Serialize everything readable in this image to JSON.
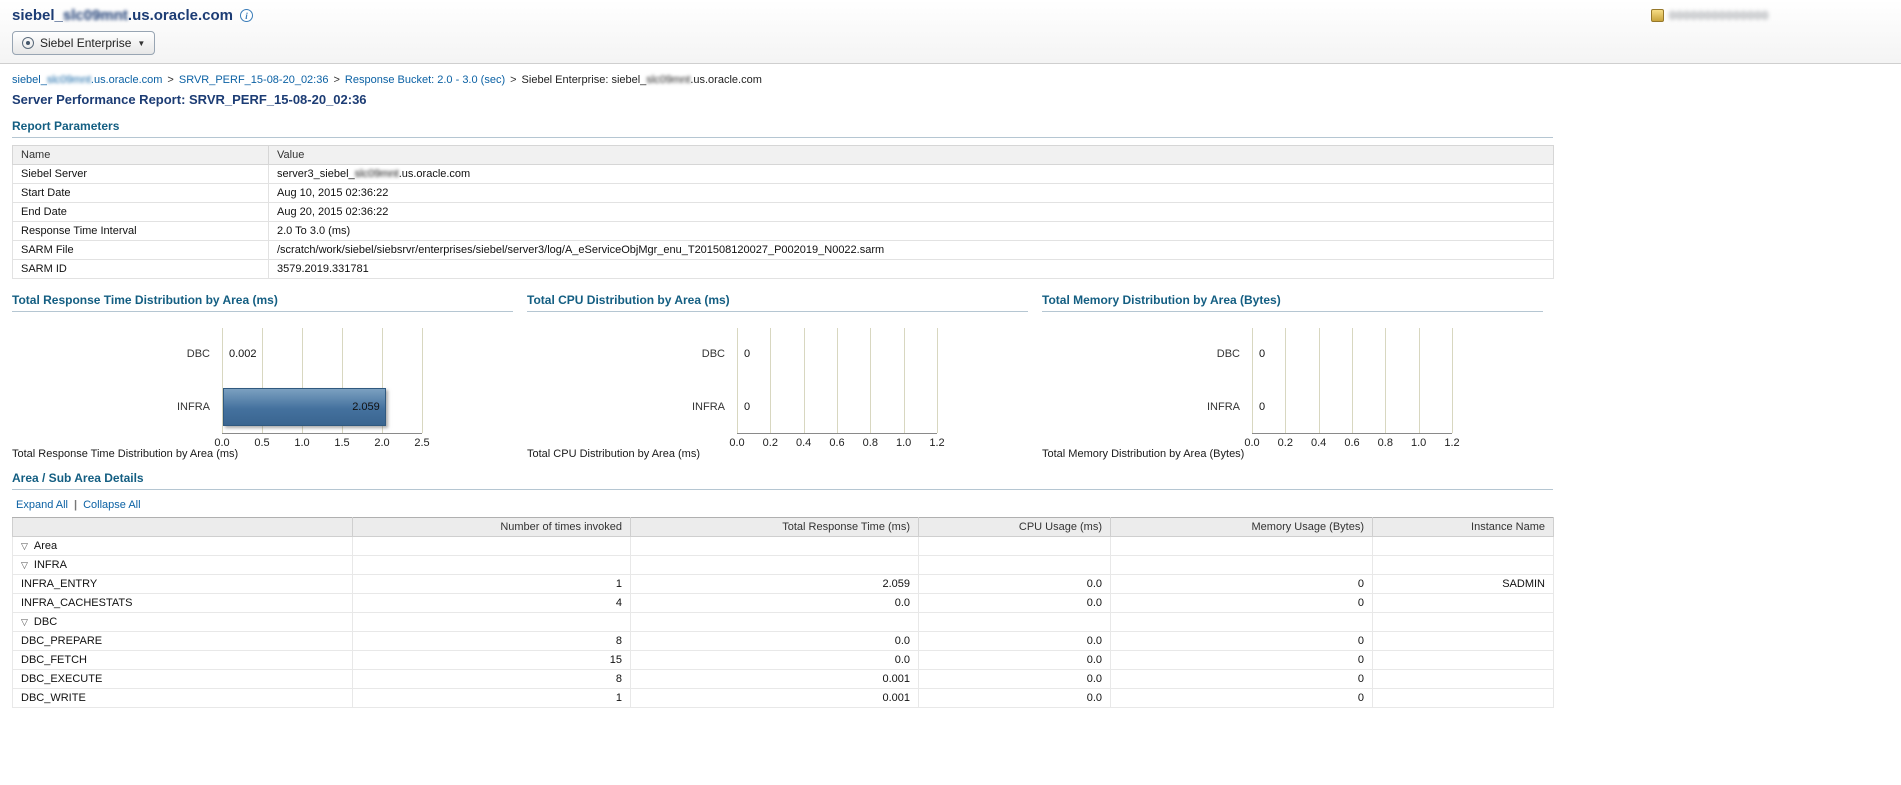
{
  "host": {
    "pre": "siebel_",
    "red": "slc09mnt",
    "post": ".us.oracle.com"
  },
  "header": {
    "info_icon": "i",
    "badge_text": "00000000000000"
  },
  "toolbar": {
    "dropdown_label": "Siebel Enterprise"
  },
  "breadcrumb": {
    "separator": ">",
    "item2": "SRVR_PERF_15-08-20_02:36",
    "item3": "Response Bucket: 2.0 - 3.0 (sec)",
    "item4_prefix": "Siebel Enterprise: "
  },
  "page_title": "Server Performance Report: SRVR_PERF_15-08-20_02:36",
  "report_parameters": {
    "heading": "Report Parameters",
    "columns": [
      "Name",
      "Value"
    ],
    "rows": [
      {
        "name": "Siebel Server",
        "value_prefix": "server3_"
      },
      {
        "name": "Start Date",
        "value": "Aug 10, 2015 02:36:22"
      },
      {
        "name": "End Date",
        "value": "Aug 20, 2015 02:36:22"
      },
      {
        "name": "Response Time Interval",
        "value": "2.0 To 3.0 (ms)"
      },
      {
        "name": "SARM File",
        "value": "/scratch/work/siebel/siebsrvr/enterprises/siebel/server3/log/A_eServiceObjMgr_enu_T201508120027_P002019_N0022.sarm"
      },
      {
        "name": "SARM ID",
        "value": "3579.2019.331781"
      }
    ]
  },
  "chart_data": [
    {
      "type": "bar",
      "orientation": "horizontal",
      "title": "Total Response Time Distribution by Area (ms)",
      "caption": "Total Response Time Distribution by Area (ms)",
      "categories": [
        "DBC",
        "INFRA"
      ],
      "values": [
        0.002,
        2.059
      ],
      "value_labels": [
        "0.002",
        "2.059"
      ],
      "xlim": [
        0,
        2.5
      ],
      "xtick_labels": [
        "0.0",
        "0.5",
        "1.0",
        "1.5",
        "2.0",
        "2.5"
      ],
      "grid": true,
      "legend": "none",
      "bar_color": "#44719e"
    },
    {
      "type": "bar",
      "orientation": "horizontal",
      "title": "Total CPU Distribution by Area (ms)",
      "caption": "Total CPU Distribution by Area (ms)",
      "categories": [
        "DBC",
        "INFRA"
      ],
      "values": [
        0,
        0
      ],
      "value_labels": [
        "0",
        "0"
      ],
      "xlim": [
        0,
        1.2
      ],
      "xtick_labels": [
        "0.0",
        "0.2",
        "0.4",
        "0.6",
        "0.8",
        "1.0",
        "1.2"
      ],
      "grid": true,
      "legend": "none",
      "bar_color": "#44719e"
    },
    {
      "type": "bar",
      "orientation": "horizontal",
      "title": "Total Memory Distribution by Area (Bytes)",
      "caption": "Total Memory Distribution by Area (Bytes)",
      "categories": [
        "DBC",
        "INFRA"
      ],
      "values": [
        0,
        0
      ],
      "value_labels": [
        "0",
        "0"
      ],
      "xlim": [
        0,
        1.2
      ],
      "xtick_labels": [
        "0.0",
        "0.2",
        "0.4",
        "0.6",
        "0.8",
        "1.0",
        "1.2"
      ],
      "grid": true,
      "legend": "none",
      "bar_color": "#44719e"
    }
  ],
  "area_details": {
    "heading": "Area / Sub Area Details",
    "expand_all_label": "Expand All",
    "collapse_all_label": "Collapse All",
    "link_separator": "|",
    "columns": [
      "",
      "Number of times invoked",
      "Total Response Time (ms)",
      "CPU Usage (ms)",
      "Memory Usage (Bytes)",
      "Instance Name"
    ],
    "rows": [
      {
        "label": "Area",
        "level": 0,
        "expandable": true,
        "cells": [
          "",
          "",
          "",
          "",
          ""
        ]
      },
      {
        "label": "INFRA",
        "level": 1,
        "expandable": true,
        "cells": [
          "",
          "",
          "",
          "",
          ""
        ]
      },
      {
        "label": "INFRA_ENTRY",
        "level": 2,
        "expandable": false,
        "cells": [
          "1",
          "2.059",
          "0.0",
          "0",
          "SADMIN"
        ]
      },
      {
        "label": "INFRA_CACHESTATS",
        "level": 2,
        "expandable": false,
        "cells": [
          "4",
          "0.0",
          "0.0",
          "0",
          ""
        ]
      },
      {
        "label": "DBC",
        "level": 1,
        "expandable": true,
        "cells": [
          "",
          "",
          "",
          "",
          ""
        ]
      },
      {
        "label": "DBC_PREPARE",
        "level": 2,
        "expandable": false,
        "cells": [
          "8",
          "0.0",
          "0.0",
          "0",
          ""
        ]
      },
      {
        "label": "DBC_FETCH",
        "level": 2,
        "expandable": false,
        "cells": [
          "15",
          "0.0",
          "0.0",
          "0",
          ""
        ]
      },
      {
        "label": "DBC_EXECUTE",
        "level": 2,
        "expandable": false,
        "cells": [
          "8",
          "0.001",
          "0.0",
          "0",
          ""
        ]
      },
      {
        "label": "DBC_WRITE",
        "level": 2,
        "expandable": false,
        "cells": [
          "1",
          "0.001",
          "0.0",
          "0",
          ""
        ]
      }
    ]
  },
  "icons": {
    "expand_open": "▽",
    "dropdown_arrow": "▼"
  }
}
